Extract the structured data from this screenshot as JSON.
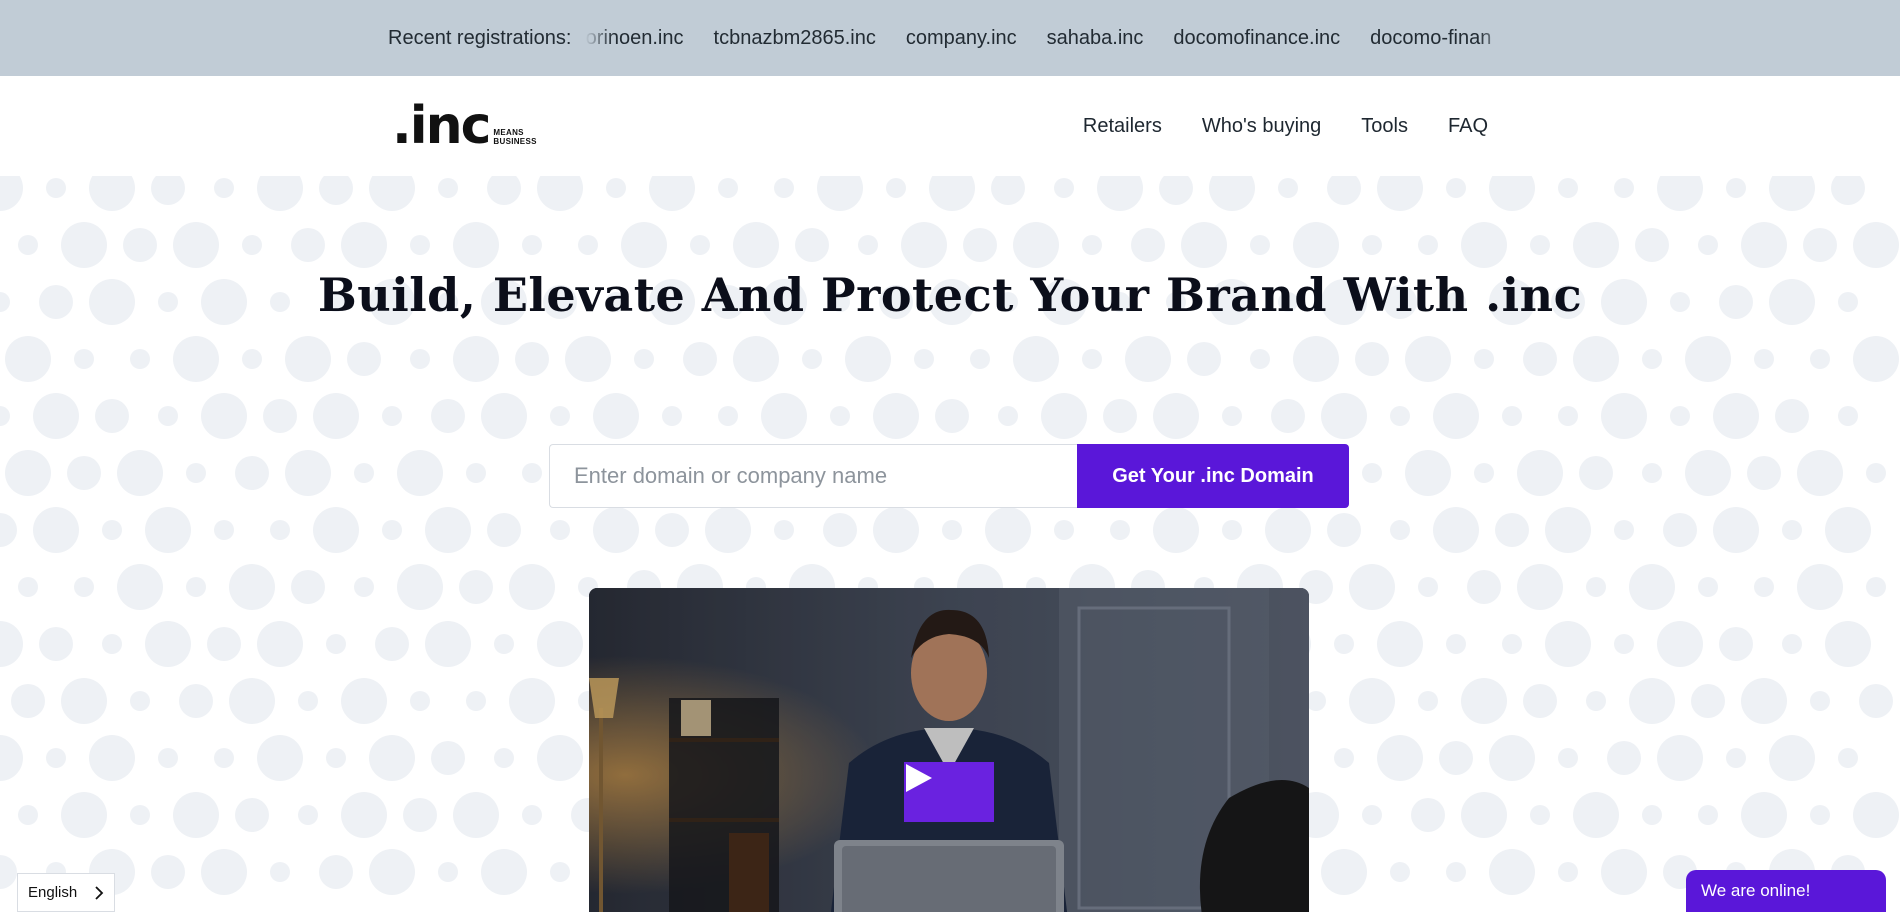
{
  "ticker": {
    "label": "Recent registrations:",
    "items": [
      "morinoen.inc",
      "tcbnazbm2865.inc",
      "company.inc",
      "sahaba.inc",
      "docomofinance.inc",
      "docomo-finan"
    ]
  },
  "header": {
    "logo_text": ".inc",
    "logo_tagline_1": "MEANS",
    "logo_tagline_2": "BUSINESS",
    "nav": [
      "Retailers",
      "Who's buying",
      "Tools",
      "FAQ"
    ]
  },
  "hero": {
    "title": "Build, Elevate And Protect Your Brand With .inc",
    "search_placeholder": "Enter domain or company name",
    "search_button": "Get Your .inc Domain",
    "video_play_icon": "play-icon"
  },
  "footer_widgets": {
    "language": "English",
    "chat": "We are online!"
  },
  "colors": {
    "accent": "#5a17d9",
    "ticker_bg": "#c1ccd6",
    "dot": "#eef1f5"
  }
}
